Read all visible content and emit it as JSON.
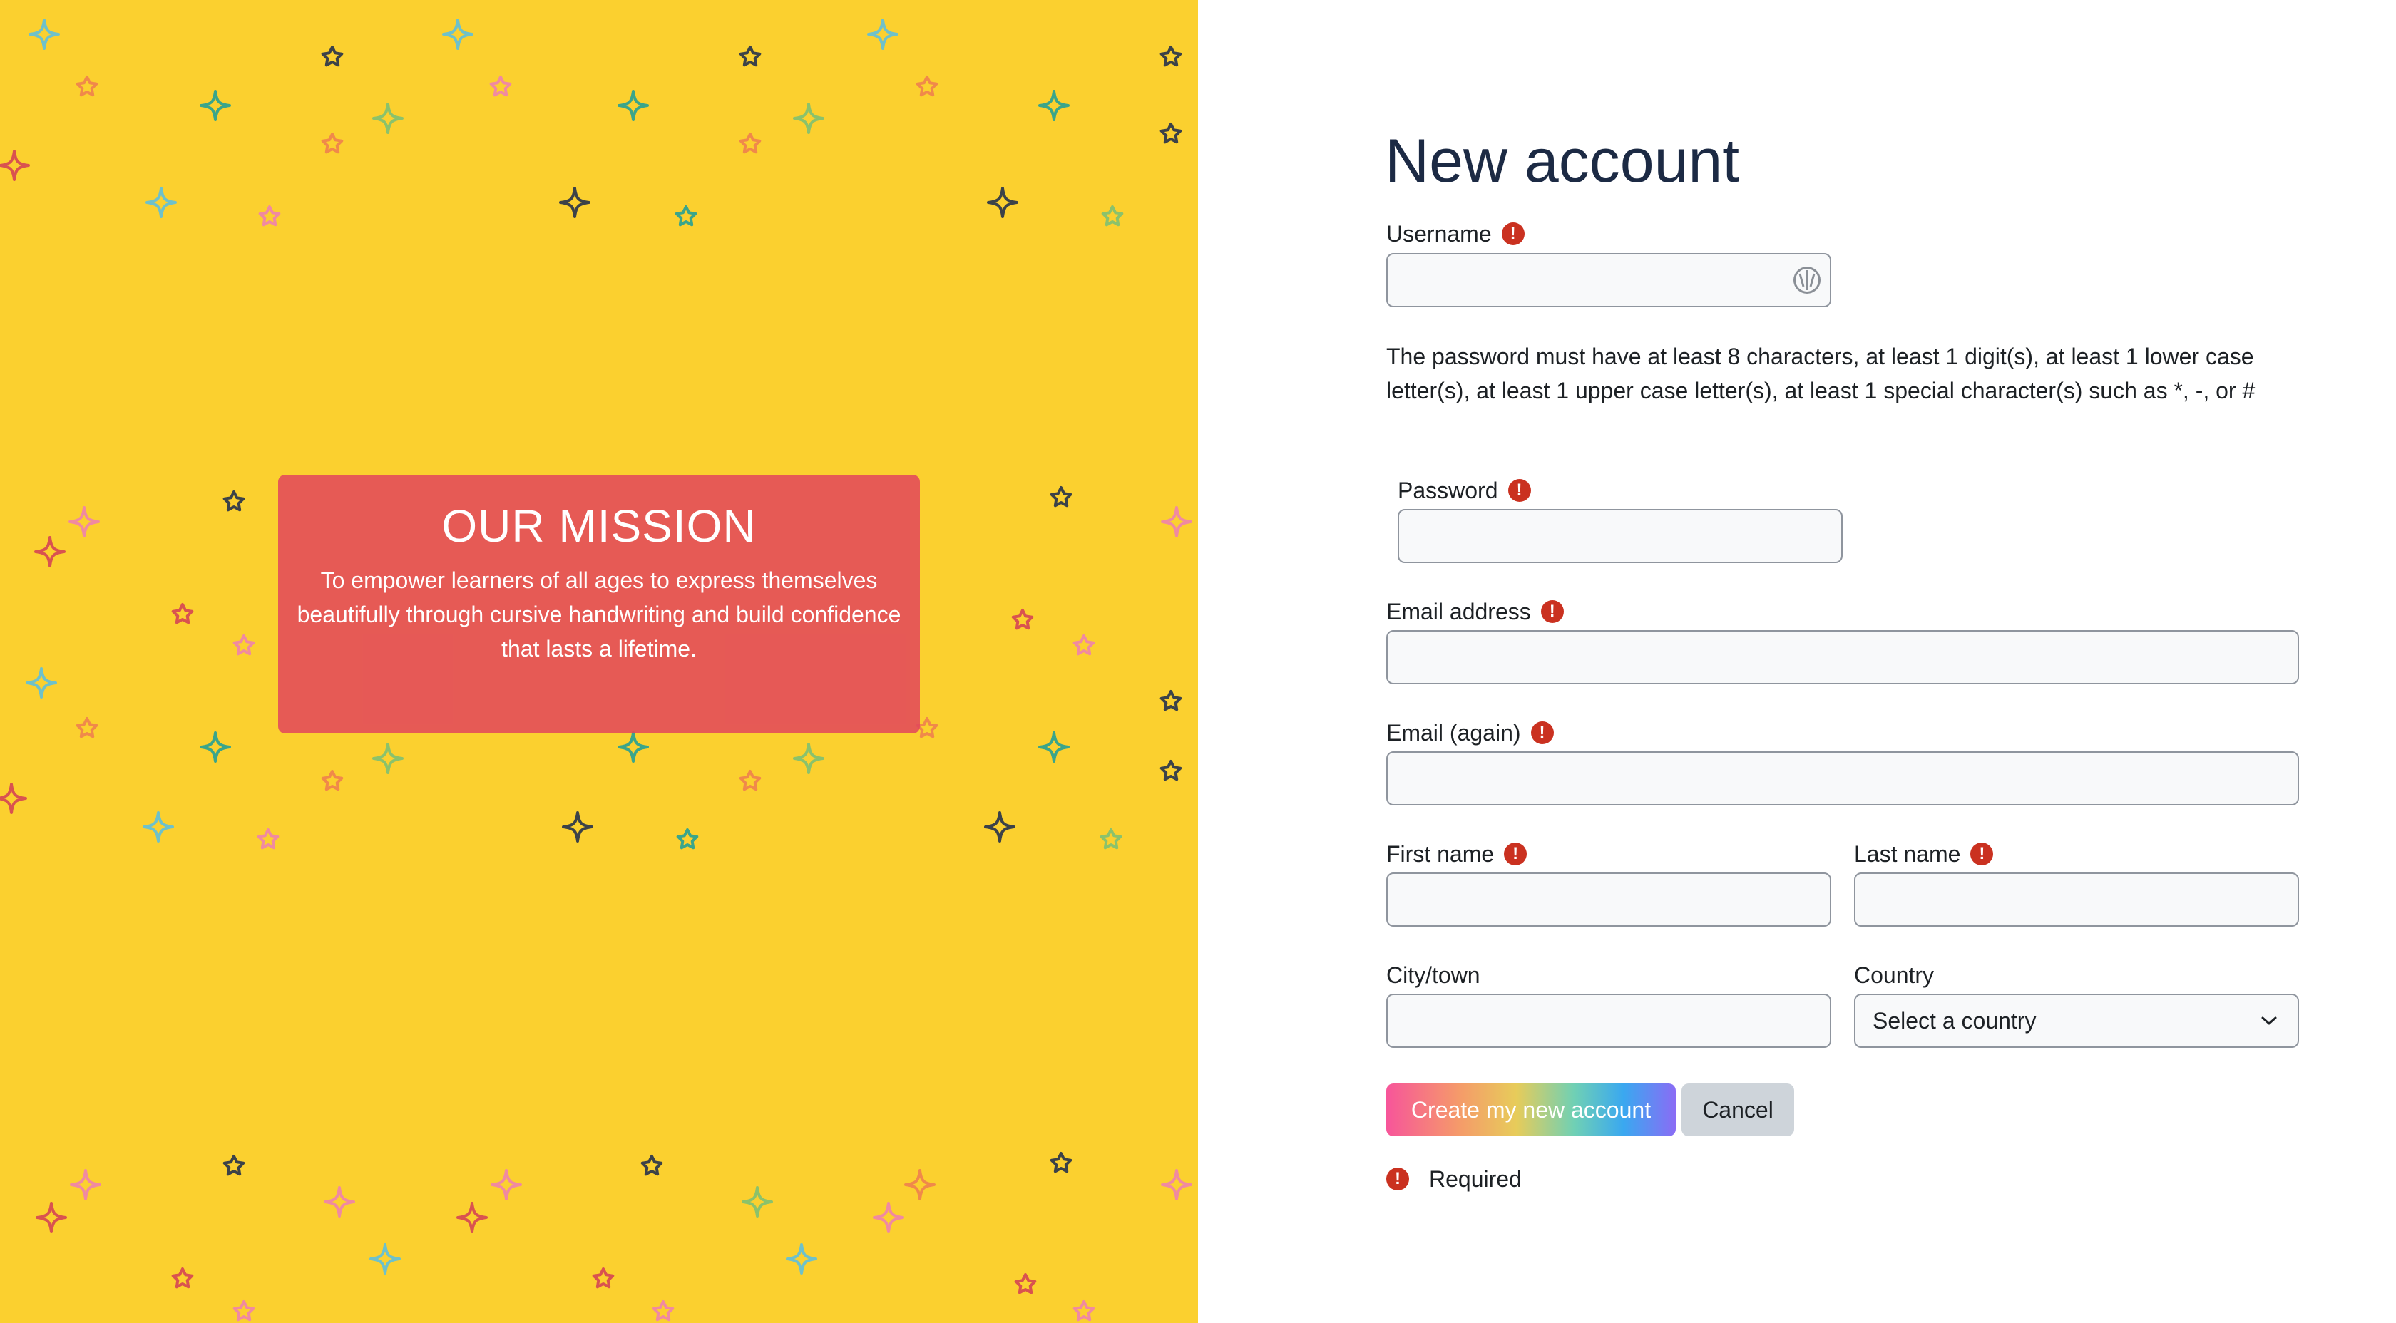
{
  "mission": {
    "title": "OUR MISSION",
    "text": "To empower learners of all ages to express themselves beautifully through cursive handwriting and build confidence that lasts a lifetime."
  },
  "form": {
    "title": "New account",
    "username_label": "Username",
    "password_policy": "The password must have at least 8 characters, at least 1 digit(s), at least 1 lower case letter(s), at least 1 upper case letter(s), at least 1 special character(s) such as *, -, or #",
    "password_label": "Password",
    "email_label": "Email address",
    "email_again_label": "Email (again)",
    "first_name_label": "First name",
    "last_name_label": "Last name",
    "city_label": "City/town",
    "country_label": "Country",
    "country_selected": "Select a country",
    "create_button": "Create my new account",
    "cancel_button": "Cancel",
    "required_note": "Required",
    "required_icon": "!"
  },
  "icons": {
    "required": "exclamation-circle-icon",
    "username_helper": "password-manager-icon",
    "dropdown": "chevron-down-icon",
    "background": "star-pattern"
  },
  "colors": {
    "left_background": "#fbd02f",
    "mission_box": "#e2465c",
    "required": "#ca3120",
    "title": "#1c2a44",
    "cancel_button": "#ced4da"
  }
}
